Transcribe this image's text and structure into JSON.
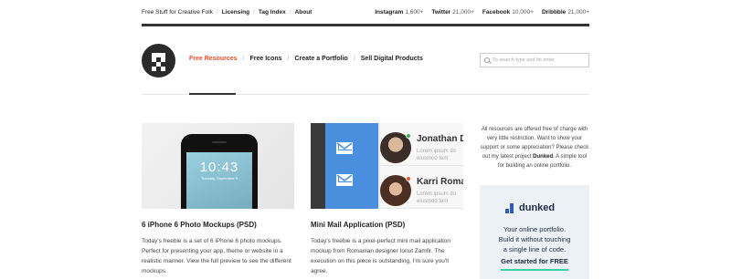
{
  "topbar": {
    "tagline": "Free Stuff for Creative Folk",
    "links": [
      "Licensing",
      "Tag Index",
      "About"
    ],
    "social": [
      {
        "name": "Instagram",
        "count": "1,600+"
      },
      {
        "name": "Twitter",
        "count": "21,000+"
      },
      {
        "name": "Facebook",
        "count": "10,000+"
      },
      {
        "name": "Dribbble",
        "count": "21,000+"
      }
    ]
  },
  "nav": {
    "items": [
      "Free Resources",
      "Free Icons",
      "Create a Portfolio",
      "Sell Digital Products"
    ],
    "active_color": "#e8512c"
  },
  "search": {
    "placeholder": "To search type and hit enter"
  },
  "cards": [
    {
      "title": "6 iPhone 6 Photo Mockups (PSD)",
      "body": "Today's freebie is a set of 6 iPhone 6 photo mockups. Perfect for presenting your app, theme or website in a realistic manner. View the full preview to see the different mockups.",
      "thumb_time": "10:43",
      "thumb_date": "Tuesday, September 9"
    },
    {
      "title": "Mini Mail Application (PSD)",
      "body": "Today's freebie is a pixel-perfect mini mail application mockup from Romanian designer Ionut Zamfir. The execution on this piece is outstanding, I'm sure you'll agree.",
      "contacts": [
        {
          "name": "Jonathan D",
          "text": "Lorem ipsum do\neiusmod tem",
          "status_color": "#3cb043"
        },
        {
          "name": "Karri Roma",
          "text": "Lorem ipsum do\neiusmod tem",
          "status_color": "#e8512c"
        }
      ]
    }
  ],
  "sidebar": {
    "text_pre": "All resources are offered free of charge with very little restriction. Want to show your support or some appreciation? Please check out my latest project ",
    "text_link": "Dunked",
    "text_post": ". A simple tool for building an online portfolio."
  },
  "ad": {
    "brand": "dunked",
    "line1": "Your online portfolio.",
    "line2": "Build it without touching",
    "line3": "a single line of code.",
    "cta": "Get started for FREE"
  }
}
